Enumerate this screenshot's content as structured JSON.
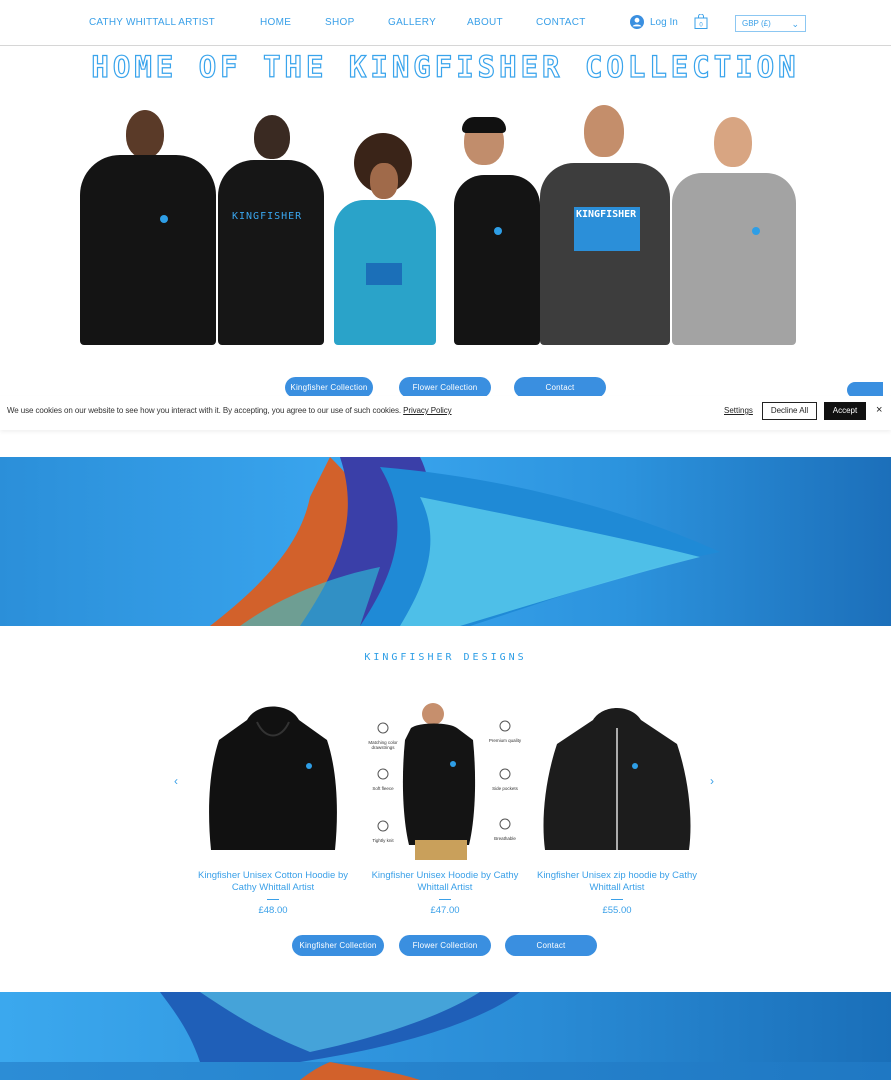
{
  "header": {
    "brand": "CATHY WHITTALL ARTIST",
    "nav": [
      "HOME",
      "SHOP",
      "GALLERY",
      "ABOUT",
      "CONTACT"
    ],
    "login": "Log In",
    "cart_count": "0",
    "currency": "GBP (£)"
  },
  "hero": {
    "title": "HOME OF THE KINGFISHER COLLECTION",
    "buttons": [
      "Kingfisher Collection",
      "Flower Collection",
      "Contact"
    ]
  },
  "cookie": {
    "text": "We use cookies on our website to see how you interact with it. By accepting, you agree to our use of such cookies.",
    "policy_link": "Privacy Policy",
    "settings": "Settings",
    "decline": "Decline All",
    "accept": "Accept",
    "close": "×"
  },
  "designs": {
    "title": "KINGFISHER DESIGNS",
    "products": [
      {
        "name": "Kingfisher Unisex Cotton Hoodie by Cathy Whittall Artist",
        "price": "£48.00"
      },
      {
        "name": "Kingfisher Unisex Hoodie by Cathy Whittall Artist",
        "price": "£47.00"
      },
      {
        "name": "Kingfisher Unisex zip hoodie by Cathy Whittall Artist",
        "price": "£55.00"
      }
    ],
    "features": [
      "Matching color drawstrings",
      "Premium quality",
      "Soft fleece",
      "Side pockets",
      "Tightly knit",
      "Breathable"
    ],
    "buttons": [
      "Kingfisher Collection",
      "Flower Collection",
      "Contact"
    ],
    "prev": "‹",
    "next": "›"
  },
  "shirt_text": "KINGFISHER",
  "colors": {
    "accent": "#3a8fe0",
    "link": "#3aa0e8",
    "banner": "#2c93dd"
  }
}
